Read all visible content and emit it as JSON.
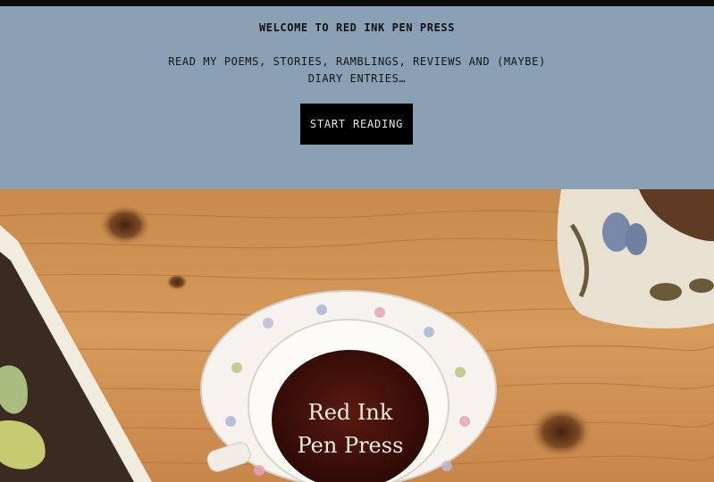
{
  "hero": {
    "title": "WELCOME TO RED INK PEN PRESS",
    "subtitle": "READ MY POEMS, STORIES, RAMBLINGS, REVIEWS AND (MAYBE) DIARY ENTRIES…",
    "cta_label": "START READING",
    "background_color": "#8aa0b5"
  },
  "photo": {
    "logo_line1": "Red Ink",
    "logo_line2": "Pen Press"
  }
}
